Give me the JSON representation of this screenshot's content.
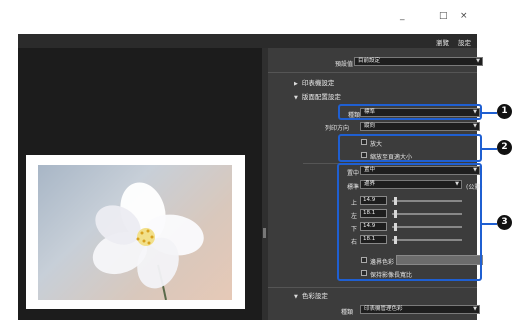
{
  "window_controls": {
    "minimize": "_",
    "maximize": "□",
    "close": "×"
  },
  "menubar": {
    "back_label": "瀏覽",
    "settings_label": "設定"
  },
  "panel": {
    "preset": {
      "label": "預設值",
      "value": "目前設定"
    },
    "print_settings_section": "印表機設定",
    "layout_section": "版面配置設定",
    "type": {
      "label": "種類",
      "value": "標準"
    },
    "orientation": {
      "label": "列印方向",
      "value": "縱向"
    },
    "enlarge_label": "放大",
    "fit_paper_label": "縮放至頁適大小",
    "position": {
      "label": "置中",
      "value": "置中"
    },
    "margin": {
      "label": "標準",
      "value": "邊界",
      "unit": "(公釐)"
    },
    "margins": [
      {
        "label": "上",
        "value": "14.9"
      },
      {
        "label": "左",
        "value": "18.1"
      },
      {
        "label": "下",
        "value": "14.9"
      },
      {
        "label": "右",
        "value": "18.1"
      }
    ],
    "border_color_label": "邊界色彩",
    "keep_aspect_label": "保持影像長寬比",
    "color_section": "色彩設定",
    "color_mgmt": {
      "label": "種類",
      "value": "印表機管理色彩"
    }
  },
  "callouts": [
    "1",
    "2",
    "3"
  ],
  "colors": {
    "callout_border": "#1f5fd1",
    "badge": "#111111",
    "panel": "#3c3c3c",
    "preview": "#1c1c1c"
  }
}
